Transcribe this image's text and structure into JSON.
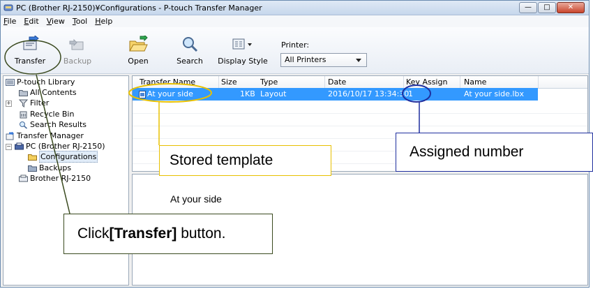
{
  "window": {
    "title": "PC (Brother RJ-2150)¥Configurations - P-touch Transfer Manager",
    "controls": [
      "minimize",
      "maximize",
      "close"
    ]
  },
  "menubar": {
    "items": [
      {
        "label": "File",
        "accel": "F"
      },
      {
        "label": "Edit",
        "accel": "E"
      },
      {
        "label": "View",
        "accel": "V"
      },
      {
        "label": "Tool",
        "accel": "T"
      },
      {
        "label": "Help",
        "accel": "H"
      }
    ]
  },
  "toolbar": {
    "transfer_label": "Transfer",
    "backup_label": "Backup",
    "open_label": "Open",
    "search_label": "Search",
    "display_style_label": "Display Style",
    "printer_label": "Printer:",
    "printer_value": "All Printers"
  },
  "tree": {
    "items": [
      {
        "label": "P-touch Library",
        "icon": "library-icon"
      },
      {
        "label": "All Contents",
        "icon": "folder-icon"
      },
      {
        "label": "Filter",
        "icon": "filter-icon"
      },
      {
        "label": "Recycle Bin",
        "icon": "recycle-bin-icon"
      },
      {
        "label": "Search Results",
        "icon": "search-icon"
      },
      {
        "label": "Transfer Manager",
        "icon": "transfer-manager-icon"
      },
      {
        "label": "PC (Brother RJ-2150)",
        "icon": "printer-icon"
      },
      {
        "label": "Configurations",
        "icon": "folder-icon"
      },
      {
        "label": "Backups",
        "icon": "folder-icon"
      },
      {
        "label": "Brother RJ-2150",
        "icon": "printer-icon"
      }
    ]
  },
  "table": {
    "columns": [
      "Transfer Name",
      "Size",
      "Type",
      "Date",
      "Key Assign",
      "Name"
    ],
    "rows": [
      {
        "transfer_name": "At your side",
        "size": "1KB",
        "type": "Layout",
        "date": "2016/10/17 13:34:30",
        "key_assign": "1",
        "name": "At your side.lbx"
      }
    ]
  },
  "preview": {
    "text": "At your side"
  },
  "annotations": {
    "stored_template": "Stored template",
    "assigned_number": "Assigned number",
    "click_prefix": "Click",
    "click_bold": "[Transfer]",
    "click_suffix": " button."
  },
  "colors": {
    "selection": "#3399ff",
    "stored_callout": "#e8c000",
    "assigned_callout": "#1e2e9e",
    "transfer_callout": "#3a4a1f"
  }
}
